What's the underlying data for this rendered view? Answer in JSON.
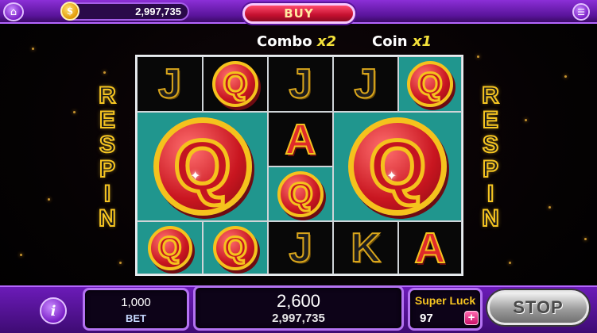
{
  "header": {
    "coin_symbol": "$",
    "coin_balance": "2,997,735",
    "buy_label": "BUY",
    "home_icon": "home-icon",
    "menu_icon": "menu-icon"
  },
  "combo": {
    "label": "Combo",
    "multiplier": "x2"
  },
  "coin": {
    "label": "Coin",
    "multiplier": "x1"
  },
  "respin_text": [
    "R",
    "E",
    "S",
    "P",
    "I",
    "N"
  ],
  "reels": {
    "small_symbols": [
      {
        "symbol": "J"
      },
      {
        "symbol": "Q"
      },
      {
        "symbol": "J"
      },
      {
        "symbol": "J"
      },
      {
        "symbol": "Q"
      },
      {
        "symbol": "A"
      },
      {
        "symbol": "Q"
      },
      {
        "symbol": "Q"
      },
      {
        "symbol": "Q"
      },
      {
        "symbol": "J"
      },
      {
        "symbol": "K"
      },
      {
        "symbol": "A"
      }
    ],
    "big_symbols": [
      {
        "symbol": "Q"
      },
      {
        "symbol": "Q"
      }
    ]
  },
  "footer": {
    "info_label": "i",
    "bet_value": "1,000",
    "bet_label": "BET",
    "win_value": "2,600",
    "win_total": "2,997,735",
    "super_luck_label": "Super Luck",
    "super_luck_value": "97",
    "plus_label": "+",
    "stop_label": "STOP"
  },
  "colors": {
    "top_bar": "#8b2fd6",
    "reel_teal": "#20968e",
    "gold": "#f5c21d",
    "red": "#c91620",
    "panel_border": "#b473f2"
  }
}
